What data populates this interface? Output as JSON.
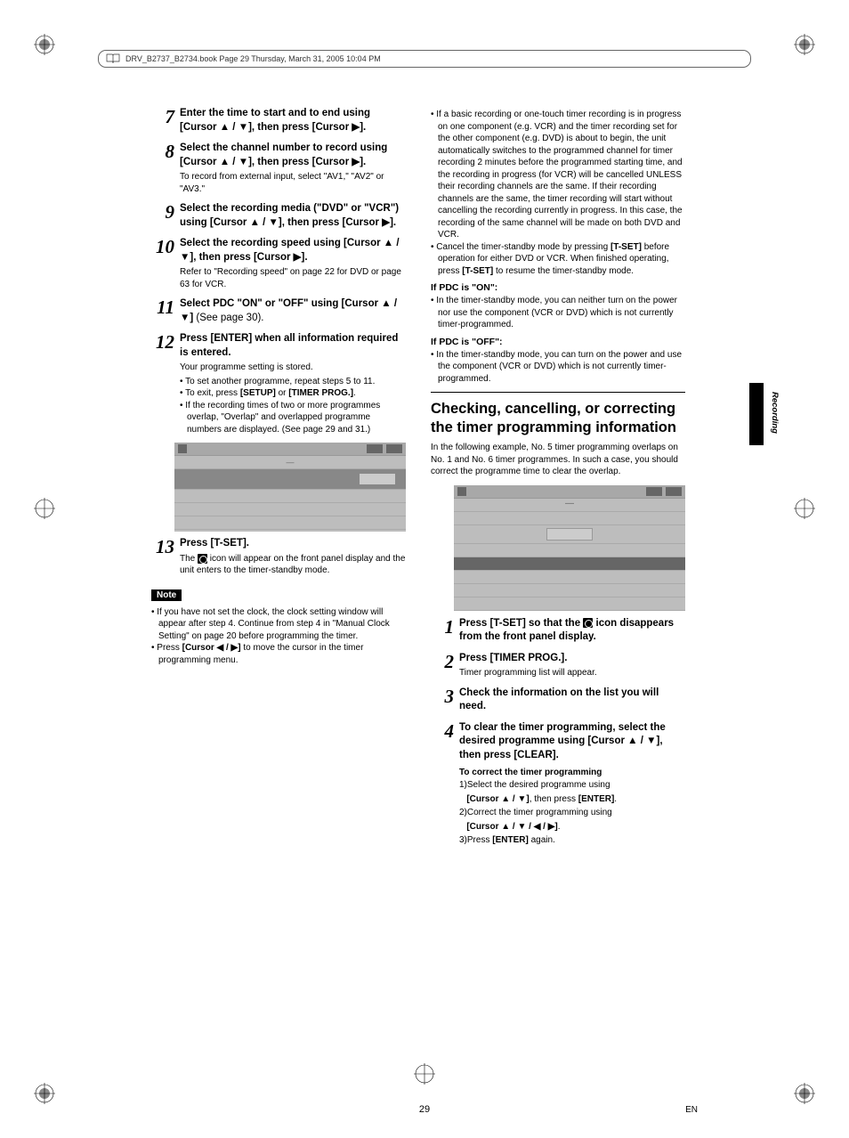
{
  "header": {
    "text": "DRV_B2737_B2734.book  Page 29  Thursday, March 31, 2005  10:04 PM"
  },
  "side_label": "Recording",
  "page_number": "29",
  "page_lang": "EN",
  "left": {
    "steps": [
      {
        "n": "7",
        "title": "Enter the time to start and to end using [Cursor ▲ / ▼], then press [Cursor ▶]."
      },
      {
        "n": "8",
        "title": "Select the channel number to record using [Cursor ▲ / ▼], then press [Cursor ▶].",
        "sub": "To record from external input, select \"AV1,\" \"AV2\" or \"AV3.\""
      },
      {
        "n": "9",
        "title": "Select the recording media (\"DVD\" or \"VCR\") using [Cursor ▲ / ▼], then press [Cursor ▶]."
      },
      {
        "n": "10",
        "title": "Select the recording speed using [Cursor ▲ / ▼], then press [Cursor ▶].",
        "sub": "Refer to \"Recording speed\" on page 22 for DVD or page 63 for VCR."
      },
      {
        "n": "11",
        "title_prefix": "Select PDC \"ON\" or \"OFF\" using [Cursor ▲ / ▼]",
        "title_suffix": " (See page 30)."
      },
      {
        "n": "12",
        "title": "Press [ENTER] when all information required is entered.",
        "sub": "Your programme setting is stored.",
        "bullets": [
          "To set another programme, repeat steps 5 to 11.",
          "To exit, press [SETUP] or [TIMER PROG.].",
          "If the recording times of two or more programmes overlap, \"Overlap\" and overlapped programme numbers are displayed. (See page 29 and 31.)"
        ]
      },
      {
        "n": "13",
        "title": "Press [T-SET].",
        "sub_after_icon": "The ⏲ icon will appear on the front panel display and the unit enters to the timer-standby mode."
      }
    ],
    "note_label": "Note",
    "note_bullets": [
      "If you have not set the clock, the clock setting window will appear after step 4. Continue from step 4 in \"Manual Clock Setting\" on page 20 before programming the timer.",
      "Press [Cursor ◀ / ▶] to move the cursor in the timer programming menu."
    ]
  },
  "right": {
    "top_bullets": [
      "If a basic recording or one-touch timer recording is in progress on one component (e.g. VCR) and the timer recording set for the other component (e.g. DVD) is about to begin, the unit automatically switches to the programmed channel for timer recording 2 minutes before the programmed starting time, and the recording in progress (for VCR) will be cancelled UNLESS their recording channels are the same.  If their recording channels are the same, the timer recording will start without cancelling the recording currently in progress.  In this case, the recording of the same channel will be made on both DVD and VCR.",
      "Cancel the timer-standby mode by pressing [T-SET] before operation for either DVD or VCR. When finished operating, press [T-SET] to resume the timer-standby mode."
    ],
    "pdc_on_label": "If PDC is \"ON\":",
    "pdc_on_bullets": [
      "In the timer-standby mode, you can neither turn on the power nor use the component (VCR or DVD) which is not currently timer-programmed."
    ],
    "pdc_off_label": "If PDC is \"OFF\":",
    "pdc_off_bullets": [
      "In the timer-standby mode, you can turn on the power and use the component (VCR or DVD) which is not currently timer-programmed."
    ],
    "section_title": "Checking, cancelling, or correcting the timer programming information",
    "section_intro": "In the following example, No. 5 timer programming overlaps on No. 1 and No. 6 timer programmes. In such a case, you should correct the programme time to clear the overlap.",
    "steps": [
      {
        "n": "1",
        "title": "Press [T-SET] so that the ⏲ icon disappears from the front panel display."
      },
      {
        "n": "2",
        "title": "Press [TIMER PROG.].",
        "sub": "Timer programming list will appear."
      },
      {
        "n": "3",
        "title": "Check the information on the list you will need."
      },
      {
        "n": "4",
        "title": "To clear the timer programming, select the desired programme using [Cursor ▲ / ▼], then press [CLEAR].",
        "sub_bold": "To correct the timer programming",
        "sub_lines": [
          "1)Select the desired programme using",
          "   [Cursor ▲ / ▼], then press [ENTER].",
          "2)Correct the timer programming using",
          "   [Cursor ▲ / ▼ / ◀ / ▶].",
          "3)Press [ENTER] again."
        ]
      }
    ]
  }
}
